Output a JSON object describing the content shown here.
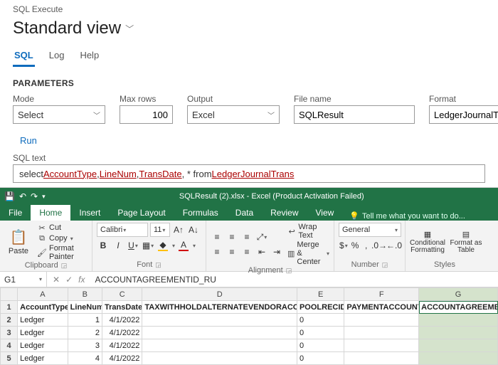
{
  "breadcrumb": "SQL Execute",
  "page_title": "Standard view",
  "tabs": {
    "sql": "SQL",
    "log": "Log",
    "help": "Help"
  },
  "parameters_heading": "PARAMETERS",
  "fields": {
    "mode": {
      "label": "Mode",
      "value": "Select"
    },
    "rows": {
      "label": "Max rows",
      "value": "100"
    },
    "output": {
      "label": "Output",
      "value": "Excel"
    },
    "file": {
      "label": "File name",
      "value": "SQLResult"
    },
    "format": {
      "label": "Format",
      "value": "LedgerJournalTrans"
    }
  },
  "run_link": "Run",
  "sql_label": "SQL text",
  "sql": {
    "p1": "select ",
    "c1": "AccountType",
    "s1": ", ",
    "c2": "LineNum",
    "s2": ", ",
    "c3": "TransDate",
    "s3": ",  * from ",
    "t1": "LedgerJournalTrans"
  },
  "excel": {
    "titlebar": "SQLResult (2).xlsx - Excel (Product Activation Failed)",
    "file_tabs": [
      "File",
      "Home",
      "Insert",
      "Page Layout",
      "Formulas",
      "Data",
      "Review",
      "View"
    ],
    "tellme_placeholder": "Tell me what you want to do...",
    "clipboard": {
      "paste": "Paste",
      "cut": "Cut",
      "copy": "Copy",
      "painter": "Format Painter",
      "group": "Clipboard"
    },
    "font": {
      "name": "Calibri",
      "size": "11",
      "group": "Font"
    },
    "alignment": {
      "wrap": "Wrap Text",
      "merge": "Merge & Center",
      "group": "Alignment"
    },
    "number": {
      "format": "General",
      "group": "Number"
    },
    "styles": {
      "cond": "Conditional Formatting",
      "ftable": "Format as Table",
      "group": "Styles"
    },
    "name_box": "G1",
    "formula_value": "ACCOUNTAGREEMENTID_RU",
    "col_letters": [
      "A",
      "B",
      "C",
      "D",
      "E",
      "F",
      "G"
    ],
    "headers": [
      "AccountType",
      "LineNum",
      "TransDate",
      "TAXWITHHOLDALTERNATEVENDORACCT_TH",
      "POOLRECID",
      "PAYMENTACCOUNT",
      "ACCOUNTAGREEMENTID"
    ],
    "rows": [
      {
        "n": "1"
      },
      {
        "n": "2",
        "a": "Ledger",
        "b": "1",
        "c": "4/1/2022",
        "d": "",
        "e": "0",
        "f": "",
        "g": ""
      },
      {
        "n": "3",
        "a": "Ledger",
        "b": "2",
        "c": "4/1/2022",
        "d": "",
        "e": "0",
        "f": "",
        "g": ""
      },
      {
        "n": "4",
        "a": "Ledger",
        "b": "3",
        "c": "4/1/2022",
        "d": "",
        "e": "0",
        "f": "",
        "g": ""
      },
      {
        "n": "5",
        "a": "Ledger",
        "b": "4",
        "c": "4/1/2022",
        "d": "",
        "e": "0",
        "f": "",
        "g": ""
      }
    ]
  }
}
